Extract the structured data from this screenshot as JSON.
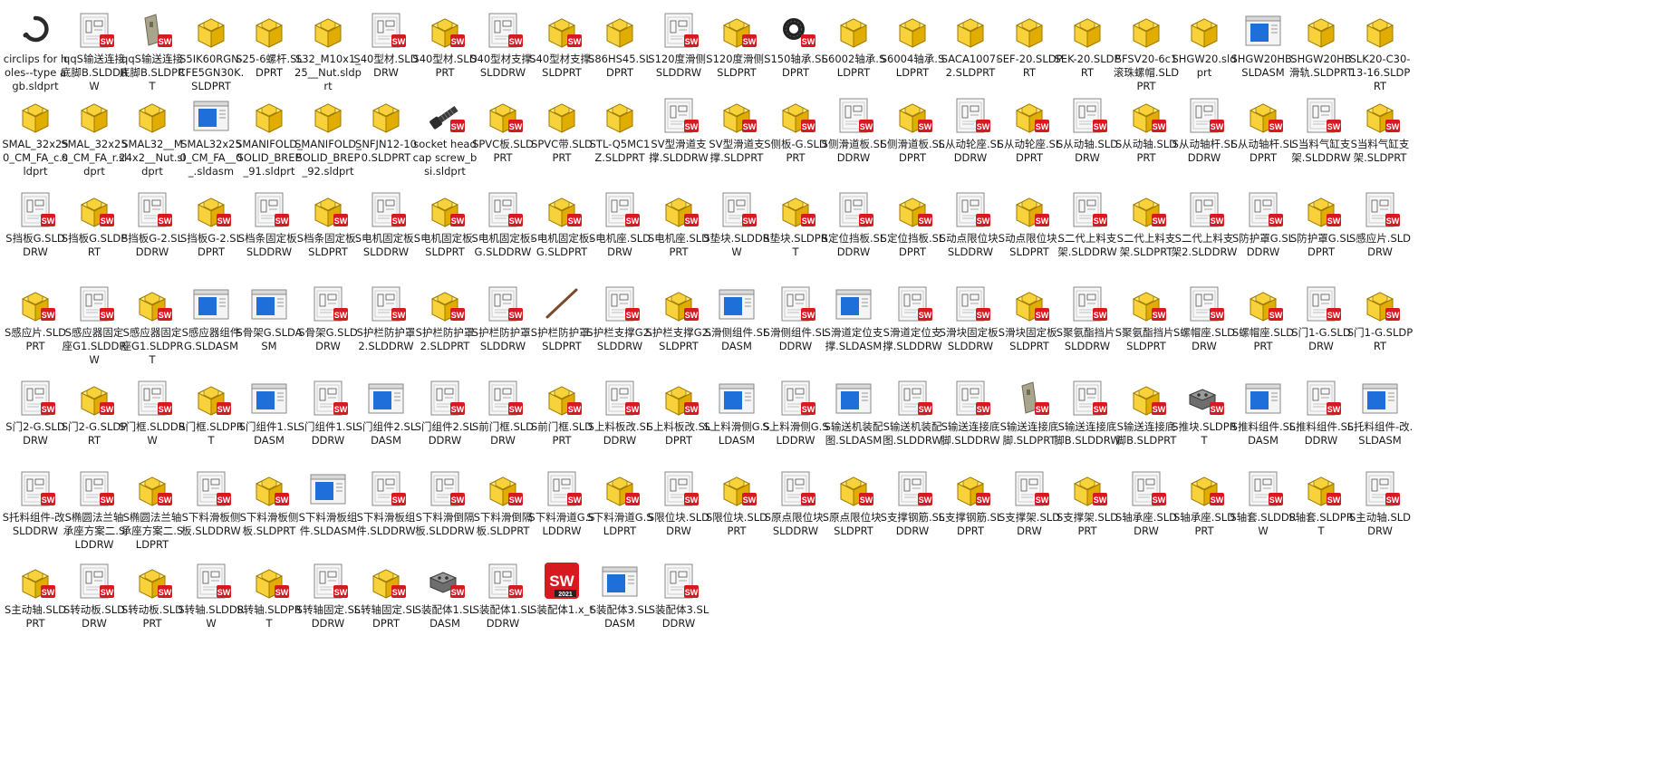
{
  "window": {
    "view": "large-icons"
  },
  "icon_kinds": {
    "part": "part-icon",
    "drawing": "drawing-icon",
    "assembly": "assembly-icon",
    "sw_app": "solidworks-2021-icon",
    "cable": "cable-icon",
    "bolt": "bolt-icon",
    "bearing": "bearing-icon",
    "ring": "clip-icon",
    "slot": "plate-icon",
    "block": "block-icon"
  },
  "colors": {
    "part_yellow": "#f2c40f",
    "part_edge": "#a07a00",
    "sw_red": "#d71920",
    "asm_blue": "#1e6fd9"
  },
  "rows": [
    [
      {
        "label": "circlips for holes--type a gb.sldprt",
        "kind": "ring",
        "badge": false
      },
      {
        "label": "qqS输送连接底脚B.SLDDRW",
        "kind": "drawing",
        "badge": true
      },
      {
        "label": "qqS输送连接底脚B.SLDPRT",
        "kind": "slot",
        "badge": true
      },
      {
        "label": "S5IK60RGN-CFE5GN30K.SLDPRT",
        "kind": "part",
        "badge": false
      },
      {
        "label": "S25-6螺杆.SLDPRT",
        "kind": "part",
        "badge": false
      },
      {
        "label": "S32_M10x1_25__Nut.sldprt",
        "kind": "part",
        "badge": false
      },
      {
        "label": "S40型材.SLDDRW",
        "kind": "drawing",
        "badge": true
      },
      {
        "label": "S40型材.SLDPRT",
        "kind": "part",
        "badge": true
      },
      {
        "label": "S40型材支撑.SLDDRW",
        "kind": "drawing",
        "badge": true
      },
      {
        "label": "S40型材支撑.SLDPRT",
        "kind": "part",
        "badge": true
      },
      {
        "label": "S86HS45.SLDPRT",
        "kind": "part",
        "badge": false
      },
      {
        "label": "S120度滑侧.SLDDRW",
        "kind": "drawing",
        "badge": true
      },
      {
        "label": "S120度滑侧.SLDPRT",
        "kind": "part",
        "badge": true
      },
      {
        "label": "S150轴承.SLDPRT",
        "kind": "bearing",
        "badge": true
      },
      {
        "label": "S6002轴承.SLDPRT",
        "kind": "part",
        "badge": false
      },
      {
        "label": "S6004轴承.SLDPRT",
        "kind": "part",
        "badge": false
      },
      {
        "label": "SACA1007-2.SLDPRT",
        "kind": "part",
        "badge": false
      },
      {
        "label": "SEF-20.SLDPRT",
        "kind": "part",
        "badge": false
      },
      {
        "label": "SEK-20.SLDPRT",
        "kind": "part",
        "badge": false
      },
      {
        "label": "SFSV20-6c1滚珠螺帽.SLDPRT",
        "kind": "part",
        "badge": false
      },
      {
        "label": "SHGW20.sldprt",
        "kind": "part",
        "badge": false
      },
      {
        "label": "SHGW20HB.SLDASM",
        "kind": "assembly",
        "badge": false
      },
      {
        "label": "SHGW20HB滑轨.SLDPRT",
        "kind": "part",
        "badge": false
      },
      {
        "label": "SLK20-C30-13-16.SLDPRT",
        "kind": "part",
        "badge": false
      }
    ],
    [
      {
        "label": "SMAL_32x250_CM_FA_c.sldprt",
        "kind": "part",
        "badge": false
      },
      {
        "label": "SMAL_32x250_CM_FA_r.sldprt",
        "kind": "part",
        "badge": false
      },
      {
        "label": "SMAL32__M24x2__Nut.sldprt",
        "kind": "part",
        "badge": false
      },
      {
        "label": "SMAL32x250_CM_FA__0_.sldasm",
        "kind": "assembly",
        "badge": false
      },
      {
        "label": "SMANIFOLD_SOLID_BREP_91.sldprt",
        "kind": "part",
        "badge": false
      },
      {
        "label": "SMANIFOLD_SOLID_BREP_92.sldprt",
        "kind": "part",
        "badge": false
      },
      {
        "label": "SNFJN12-100.SLDPRT",
        "kind": "part",
        "badge": false
      },
      {
        "label": "socket head cap screw_bsi.sldprt",
        "kind": "bolt",
        "badge": true
      },
      {
        "label": "SPVC板.SLDPRT",
        "kind": "part",
        "badge": true
      },
      {
        "label": "SPVC带.SLDPRT",
        "kind": "part",
        "badge": false
      },
      {
        "label": "STL-Q5MC1Z.SLDPRT",
        "kind": "part",
        "badge": false
      },
      {
        "label": "SV型滑道支撑.SLDDRW",
        "kind": "drawing",
        "badge": true
      },
      {
        "label": "SV型滑道支撑.SLDPRT",
        "kind": "part",
        "badge": true
      },
      {
        "label": "S侧板-G.SLDPRT",
        "kind": "part",
        "badge": true
      },
      {
        "label": "S侧滑道板.SLDDRW",
        "kind": "drawing",
        "badge": true
      },
      {
        "label": "S侧滑道板.SLDPRT",
        "kind": "part",
        "badge": true
      },
      {
        "label": "S从动轮座.SLDDRW",
        "kind": "drawing",
        "badge": true
      },
      {
        "label": "S从动轮座.SLDPRT",
        "kind": "part",
        "badge": true
      },
      {
        "label": "S从动轴.SLDDRW",
        "kind": "drawing",
        "badge": true
      },
      {
        "label": "S从动轴.SLDPRT",
        "kind": "part",
        "badge": true
      },
      {
        "label": "S从动轴杆.SLDDRW",
        "kind": "drawing",
        "badge": true
      },
      {
        "label": "S从动轴杆.SLDPRT",
        "kind": "part",
        "badge": true
      },
      {
        "label": "S当料气缸支架.SLDDRW",
        "kind": "drawing",
        "badge": true
      },
      {
        "label": "S当料气缸支架.SLDPRT",
        "kind": "part",
        "badge": true
      }
    ],
    [
      {
        "label": "S挡板G.SLDDRW",
        "kind": "drawing",
        "badge": true
      },
      {
        "label": "S挡板G.SLDPRT",
        "kind": "part",
        "badge": true
      },
      {
        "label": "S挡板G-2.SLDDRW",
        "kind": "drawing",
        "badge": true
      },
      {
        "label": "S挡板G-2.SLDPRT",
        "kind": "part",
        "badge": true
      },
      {
        "label": "S档条固定板.SLDDRW",
        "kind": "drawing",
        "badge": true
      },
      {
        "label": "S档条固定板.SLDPRT",
        "kind": "part",
        "badge": true
      },
      {
        "label": "S电机固定板.SLDDRW",
        "kind": "drawing",
        "badge": true
      },
      {
        "label": "S电机固定板.SLDPRT",
        "kind": "part",
        "badge": true
      },
      {
        "label": "S电机固定板-G.SLDDRW",
        "kind": "drawing",
        "badge": true
      },
      {
        "label": "S电机固定板-G.SLDPRT",
        "kind": "part",
        "badge": true
      },
      {
        "label": "S电机座.SLDDRW",
        "kind": "drawing",
        "badge": true
      },
      {
        "label": "S电机座.SLDPRT",
        "kind": "part",
        "badge": true
      },
      {
        "label": "S垫块.SLDDRW",
        "kind": "drawing",
        "badge": true
      },
      {
        "label": "S垫块.SLDPRT",
        "kind": "part",
        "badge": true
      },
      {
        "label": "S定位挡板.SLDDRW",
        "kind": "drawing",
        "badge": true
      },
      {
        "label": "S定位挡板.SLDPRT",
        "kind": "part",
        "badge": true
      },
      {
        "label": "S动点限位块.SLDDRW",
        "kind": "drawing",
        "badge": true
      },
      {
        "label": "S动点限位块.SLDPRT",
        "kind": "part",
        "badge": true
      },
      {
        "label": "S二代上料支架.SLDDRW",
        "kind": "drawing",
        "badge": true
      },
      {
        "label": "S二代上料支架.SLDPRT",
        "kind": "part",
        "badge": true
      },
      {
        "label": "S二代上料支架2.SLDDRW",
        "kind": "drawing",
        "badge": true
      },
      {
        "label": "S防护罩G.SLDDRW",
        "kind": "drawing",
        "badge": true
      },
      {
        "label": "S防护罩G.SLDPRT",
        "kind": "part",
        "badge": true
      },
      {
        "label": "S感应片.SLDDRW",
        "kind": "drawing",
        "badge": true
      }
    ],
    [
      {
        "label": "S感应片.SLDPRT",
        "kind": "part",
        "badge": true
      },
      {
        "label": "S感应器固定座G1.SLDDRW",
        "kind": "drawing",
        "badge": true
      },
      {
        "label": "S感应器固定座G1.SLDPRT",
        "kind": "part",
        "badge": true
      },
      {
        "label": "S感应器组件G.SLDASM",
        "kind": "assembly",
        "badge": false
      },
      {
        "label": "S骨架G.SLDASM",
        "kind": "assembly",
        "badge": false
      },
      {
        "label": "S骨架G.SLDDRW",
        "kind": "drawing",
        "badge": true
      },
      {
        "label": "S护栏防护罩2.SLDDRW",
        "kind": "drawing",
        "badge": true
      },
      {
        "label": "S护栏防护罩2.SLDPRT",
        "kind": "part",
        "badge": true
      },
      {
        "label": "S护栏防护罩.SLDDRW",
        "kind": "drawing",
        "badge": true
      },
      {
        "label": "S护栏防护罩.SLDPRT",
        "kind": "cable",
        "badge": false
      },
      {
        "label": "S护栏支撑G2.SLDDRW",
        "kind": "drawing",
        "badge": true
      },
      {
        "label": "S护栏支撑G2.SLDPRT",
        "kind": "part",
        "badge": true
      },
      {
        "label": "S滑侧组件.SLDASM",
        "kind": "assembly",
        "badge": false
      },
      {
        "label": "S滑侧组件.SLDDRW",
        "kind": "drawing",
        "badge": true
      },
      {
        "label": "S滑道定位支撑.SLDASM",
        "kind": "assembly",
        "badge": false
      },
      {
        "label": "S滑道定位支撑.SLDDRW",
        "kind": "drawing",
        "badge": true
      },
      {
        "label": "S滑块固定板.SLDDRW",
        "kind": "drawing",
        "badge": true
      },
      {
        "label": "S滑块固定板.SLDPRT",
        "kind": "part",
        "badge": true
      },
      {
        "label": "S聚氨酯挡片.SLDDRW",
        "kind": "drawing",
        "badge": true
      },
      {
        "label": "S聚氨酯挡片.SLDPRT",
        "kind": "part",
        "badge": true
      },
      {
        "label": "S螺帽座.SLDDRW",
        "kind": "drawing",
        "badge": true
      },
      {
        "label": "S螺帽座.SLDPRT",
        "kind": "part",
        "badge": true
      },
      {
        "label": "S门1-G.SLDDRW",
        "kind": "drawing",
        "badge": true
      },
      {
        "label": "S门1-G.SLDPRT",
        "kind": "part",
        "badge": true
      }
    ],
    [
      {
        "label": "S门2-G.SLDDRW",
        "kind": "drawing",
        "badge": true
      },
      {
        "label": "S门2-G.SLDPRT",
        "kind": "part",
        "badge": true
      },
      {
        "label": "S门框.SLDDRW",
        "kind": "drawing",
        "badge": true
      },
      {
        "label": "S门框.SLDPRT",
        "kind": "part",
        "badge": true
      },
      {
        "label": "S门组件1.SLDASM",
        "kind": "assembly",
        "badge": false
      },
      {
        "label": "S门组件1.SLDDRW",
        "kind": "drawing",
        "badge": true
      },
      {
        "label": "S门组件2.SLDASM",
        "kind": "assembly",
        "badge": false
      },
      {
        "label": "S门组件2.SLDDRW",
        "kind": "drawing",
        "badge": true
      },
      {
        "label": "S前门框.SLDDRW",
        "kind": "drawing",
        "badge": true
      },
      {
        "label": "S前门框.SLDPRT",
        "kind": "part",
        "badge": true
      },
      {
        "label": "S上料板改.SLDDRW",
        "kind": "drawing",
        "badge": true
      },
      {
        "label": "S上料板改.SLDPRT",
        "kind": "part",
        "badge": true
      },
      {
        "label": "S上料滑侧G.SLDASM",
        "kind": "assembly",
        "badge": false
      },
      {
        "label": "S上料滑侧G.SLDDRW",
        "kind": "drawing",
        "badge": true
      },
      {
        "label": "S输送机装配图.SLDASM",
        "kind": "assembly",
        "badge": false
      },
      {
        "label": "S输送机装配图.SLDDRW",
        "kind": "drawing",
        "badge": true
      },
      {
        "label": "S输送连接底脚.SLDDRW",
        "kind": "drawing",
        "badge": true
      },
      {
        "label": "S输送连接底脚.SLDPRT",
        "kind": "slot",
        "badge": true
      },
      {
        "label": "S输送连接底脚B.SLDDRW",
        "kind": "drawing",
        "badge": true
      },
      {
        "label": "S输送连接底脚B.SLDPRT",
        "kind": "part",
        "badge": true
      },
      {
        "label": "S推块.SLDPRT",
        "kind": "block",
        "badge": true
      },
      {
        "label": "S推料组件.SLDASM",
        "kind": "assembly",
        "badge": false
      },
      {
        "label": "S推料组件.SLDDRW",
        "kind": "drawing",
        "badge": true
      },
      {
        "label": "S托料组件-改.SLDASM",
        "kind": "assembly",
        "badge": false
      }
    ],
    [
      {
        "label": "S托料组件-改.SLDDRW",
        "kind": "drawing",
        "badge": true
      },
      {
        "label": "S椭圆法兰轴承座方案二.SLDDRW",
        "kind": "drawing",
        "badge": true
      },
      {
        "label": "S椭圆法兰轴承座方案二.SLDPRT",
        "kind": "part",
        "badge": true
      },
      {
        "label": "S下料滑板侧板.SLDDRW",
        "kind": "drawing",
        "badge": true
      },
      {
        "label": "S下料滑板侧板.SLDPRT",
        "kind": "part",
        "badge": true
      },
      {
        "label": "S下料滑板组件.SLDASM",
        "kind": "assembly",
        "badge": false
      },
      {
        "label": "S下料滑板组件.SLDDRW",
        "kind": "drawing",
        "badge": true
      },
      {
        "label": "S下料滑倒隔板.SLDDRW",
        "kind": "drawing",
        "badge": true
      },
      {
        "label": "S下料滑倒隔板.SLDPRT",
        "kind": "part",
        "badge": true
      },
      {
        "label": "S下料滑道G.SLDDRW",
        "kind": "drawing",
        "badge": true
      },
      {
        "label": "S下料滑道G.SLDPRT",
        "kind": "part",
        "badge": true
      },
      {
        "label": "S限位块.SLDDRW",
        "kind": "drawing",
        "badge": true
      },
      {
        "label": "S限位块.SLDPRT",
        "kind": "part",
        "badge": true
      },
      {
        "label": "S原点限位块.SLDDRW",
        "kind": "drawing",
        "badge": true
      },
      {
        "label": "S原点限位块.SLDPRT",
        "kind": "part",
        "badge": true
      },
      {
        "label": "S支撑钢筋.SLDDRW",
        "kind": "drawing",
        "badge": true
      },
      {
        "label": "S支撑钢筋.SLDPRT",
        "kind": "part",
        "badge": true
      },
      {
        "label": "S支撑架.SLDDRW",
        "kind": "drawing",
        "badge": true
      },
      {
        "label": "S支撑架.SLDPRT",
        "kind": "part",
        "badge": true
      },
      {
        "label": "S轴承座.SLDDRW",
        "kind": "drawing",
        "badge": true
      },
      {
        "label": "S轴承座.SLDPRT",
        "kind": "part",
        "badge": true
      },
      {
        "label": "S轴套.SLDDRW",
        "kind": "drawing",
        "badge": true
      },
      {
        "label": "S轴套.SLDPRT",
        "kind": "part",
        "badge": true
      },
      {
        "label": "S主动轴.SLDDRW",
        "kind": "drawing",
        "badge": true
      }
    ],
    [
      {
        "label": "S主动轴.SLDPRT",
        "kind": "part",
        "badge": true
      },
      {
        "label": "S转动板.SLDDRW",
        "kind": "drawing",
        "badge": true
      },
      {
        "label": "S转动板.SLDPRT",
        "kind": "part",
        "badge": true
      },
      {
        "label": "S转轴.SLDDRW",
        "kind": "drawing",
        "badge": true
      },
      {
        "label": "S转轴.SLDPRT",
        "kind": "part",
        "badge": true
      },
      {
        "label": "S转轴固定.SLDDRW",
        "kind": "drawing",
        "badge": true
      },
      {
        "label": "S转轴固定.SLDPRT",
        "kind": "part",
        "badge": true
      },
      {
        "label": "S装配体1.SLDASM",
        "kind": "block",
        "badge": true
      },
      {
        "label": "S装配体1.SLDDRW",
        "kind": "drawing",
        "badge": true
      },
      {
        "label": "S装配体1.x_t",
        "kind": "sw_app",
        "badge": false,
        "sw_label": "SW",
        "sw_year": "2021"
      },
      {
        "label": "S装配体3.SLDASM",
        "kind": "assembly",
        "badge": false
      },
      {
        "label": "S装配体3.SLDDRW",
        "kind": "drawing",
        "badge": true
      }
    ]
  ]
}
